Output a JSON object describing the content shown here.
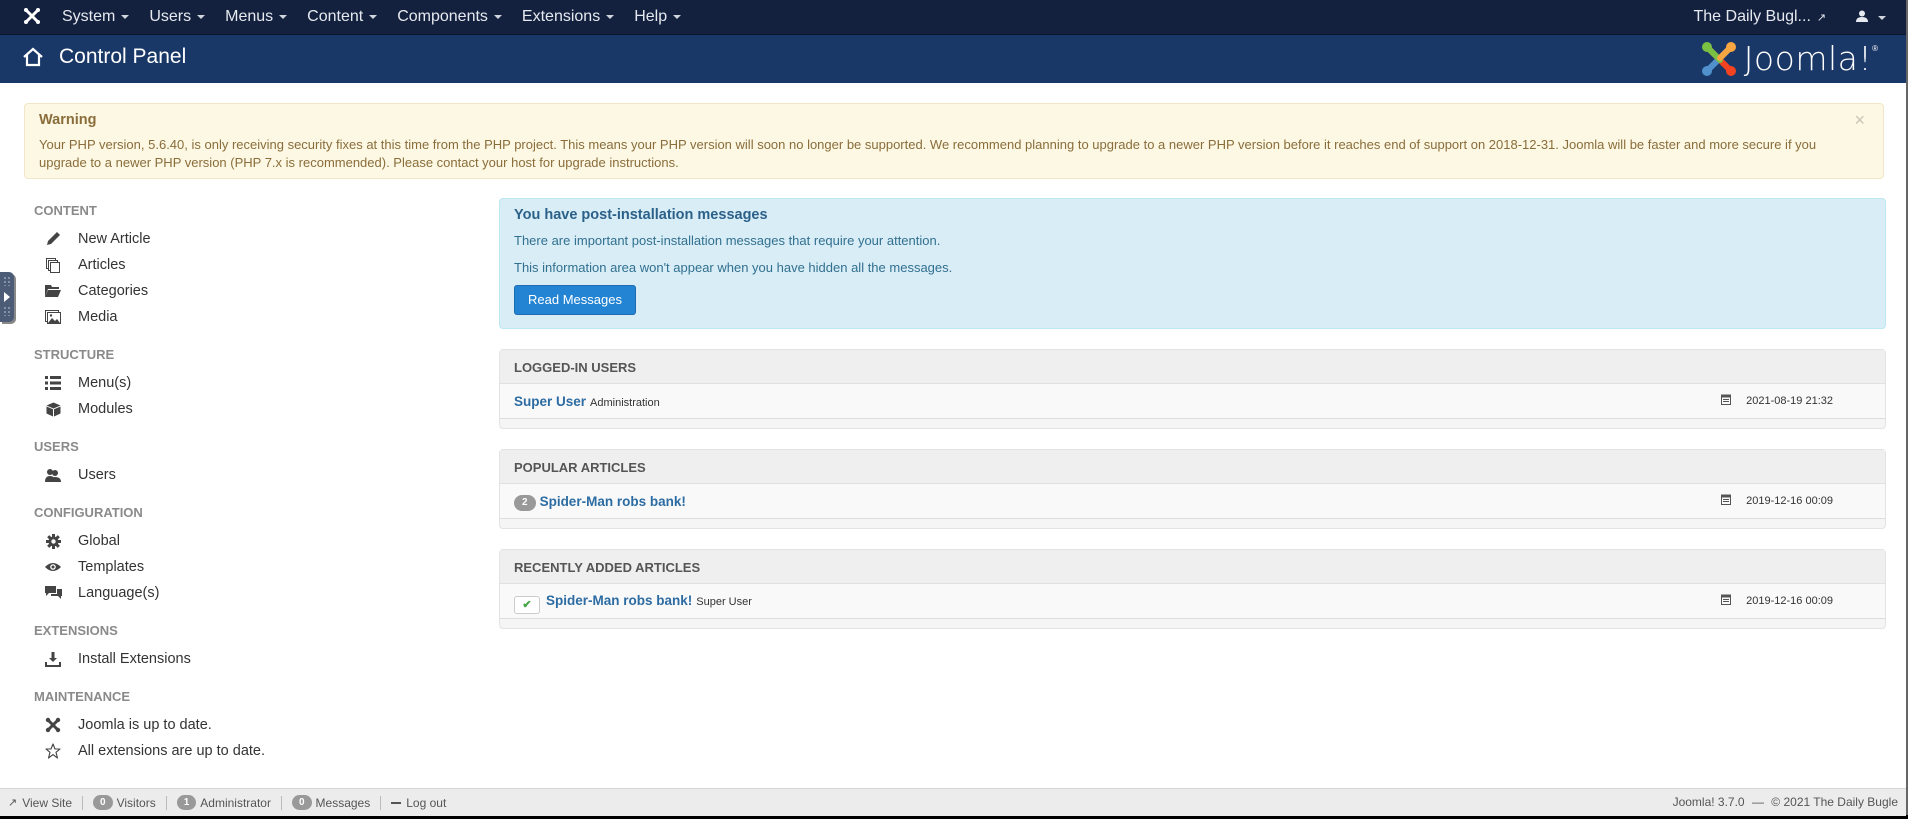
{
  "topnav": {
    "menu": [
      {
        "label": "System"
      },
      {
        "label": "Users"
      },
      {
        "label": "Menus"
      },
      {
        "label": "Content"
      },
      {
        "label": "Components"
      },
      {
        "label": "Extensions"
      },
      {
        "label": "Help"
      }
    ],
    "site_name": "The Daily Bugl...",
    "site_icon": "external-link-icon",
    "user_icon": "user-icon"
  },
  "header": {
    "title": "Control Panel",
    "icon": "home-icon",
    "brand": "Joomla!",
    "brand_reg": "®"
  },
  "warning": {
    "title": "Warning",
    "body": "Your PHP version, 5.6.40, is only receiving security fixes at this time from the PHP project. This means your PHP version will soon no longer be supported. We recommend planning to upgrade to a newer PHP version before it reaches end of support on 2018-12-31. Joomla will be faster and more secure if you upgrade to a newer PHP version (PHP 7.x is recommended). Please contact your host for upgrade instructions.",
    "close": "×"
  },
  "sidebar": {
    "sections": [
      {
        "title": "CONTENT",
        "items": [
          {
            "label": "New Article",
            "icon": "pencil-icon"
          },
          {
            "label": "Articles",
            "icon": "stack-icon"
          },
          {
            "label": "Categories",
            "icon": "folder-open-icon"
          },
          {
            "label": "Media",
            "icon": "image-icon"
          }
        ]
      },
      {
        "title": "STRUCTURE",
        "items": [
          {
            "label": "Menu(s)",
            "icon": "list-icon"
          },
          {
            "label": "Modules",
            "icon": "cube-icon"
          }
        ]
      },
      {
        "title": "USERS",
        "items": [
          {
            "label": "Users",
            "icon": "users-icon"
          }
        ]
      },
      {
        "title": "CONFIGURATION",
        "items": [
          {
            "label": "Global",
            "icon": "cog-icon"
          },
          {
            "label": "Templates",
            "icon": "eye-icon"
          },
          {
            "label": "Language(s)",
            "icon": "comments-icon"
          }
        ]
      },
      {
        "title": "EXTENSIONS",
        "items": [
          {
            "label": "Install Extensions",
            "icon": "download-icon"
          }
        ]
      },
      {
        "title": "MAINTENANCE",
        "items": [
          {
            "label": "Joomla is up to date.",
            "icon": "joomla-icon"
          },
          {
            "label": "All extensions are up to date.",
            "icon": "star-empty-icon"
          }
        ]
      }
    ]
  },
  "postinstall": {
    "title": "You have post-installation messages",
    "line1": "There are important post-installation messages that require your attention.",
    "line2": "This information area won't appear when you have hidden all the messages.",
    "button": "Read Messages"
  },
  "modules": {
    "logged_in": {
      "title": "LOGGED-IN USERS",
      "rows": [
        {
          "name": "Super User",
          "sub": "Administration",
          "date": "2021-08-19 21:32"
        }
      ]
    },
    "popular": {
      "title": "POPULAR ARTICLES",
      "rows": [
        {
          "hits": "2",
          "name": "Spider-Man robs bank!",
          "date": "2019-12-16 00:09"
        }
      ]
    },
    "recent": {
      "title": "RECENTLY ADDED ARTICLES",
      "rows": [
        {
          "status": "published",
          "name": "Spider-Man robs bank!",
          "sub": "Super User",
          "date": "2019-12-16 00:09"
        }
      ]
    }
  },
  "footer": {
    "view_site": "View Site",
    "visitors_count": "0",
    "visitors_label": "Visitors",
    "admin_count": "1",
    "admin_label": "Administrator",
    "messages_count": "0",
    "messages_label": "Messages",
    "logout": "Log out",
    "version": "Joomla! 3.7.0",
    "dash": "—",
    "copyright": "© 2021 The Daily Bugle"
  },
  "colors": {
    "topnav_bg": "#13213f",
    "header_bg": "#1a3867",
    "link": "#2d6ca2",
    "button": "#2384d3",
    "warning_bg": "#fcf8e3",
    "info_bg": "#d9edf7"
  }
}
